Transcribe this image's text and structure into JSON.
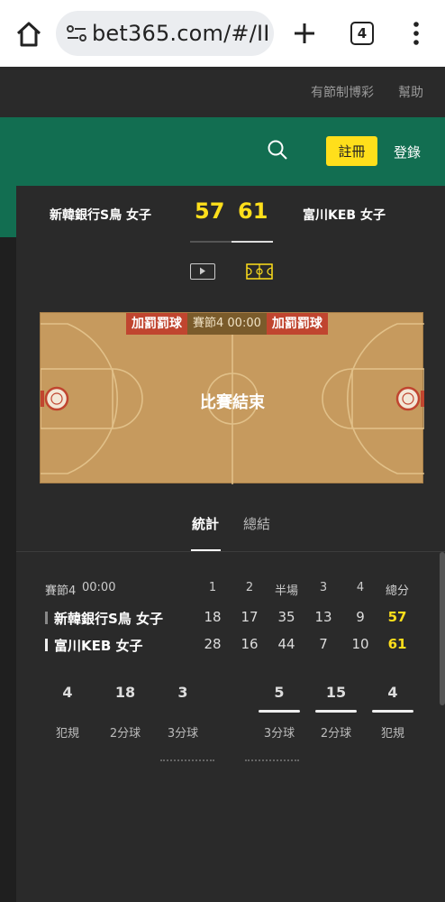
{
  "browser": {
    "url": "bet365.com/#/II",
    "tab_count": "4"
  },
  "top_links": {
    "responsible_gambling": "有節制博彩",
    "help": "幫助"
  },
  "header": {
    "register_label": "註冊",
    "login_label": "登錄"
  },
  "match": {
    "home_team": "新韓銀行S鳥 女子",
    "away_team": "富川KEB 女子",
    "home_score": "57",
    "away_score": "61",
    "court": {
      "left_banner": "加罰罰球",
      "period_time": "賽節4  00:00",
      "right_banner": "加罰罰球",
      "status": "比賽結束"
    }
  },
  "stat_tabs": {
    "stats": "統計",
    "summary": "總結"
  },
  "score_table": {
    "period_label": "賽節4",
    "clock": "00:00",
    "headers": [
      "1",
      "2",
      "半場",
      "3",
      "4",
      "總分"
    ],
    "rows": [
      {
        "team": "新韓銀行S鳥 女子",
        "values": [
          "18",
          "17",
          "35",
          "13",
          "9",
          "57"
        ]
      },
      {
        "team": "富川KEB 女子",
        "values": [
          "28",
          "16",
          "44",
          "7",
          "10",
          "61"
        ]
      }
    ]
  },
  "team_stats": {
    "home": [
      {
        "value": "4",
        "label": "犯規"
      },
      {
        "value": "18",
        "label": "2分球"
      },
      {
        "value": "3",
        "label": "3分球"
      }
    ],
    "away": [
      {
        "value": "5",
        "label": "3分球"
      },
      {
        "value": "15",
        "label": "2分球"
      },
      {
        "value": "4",
        "label": "犯規"
      }
    ]
  },
  "colors": {
    "accent_yellow": "#ffdf1b",
    "brand_green": "#126e51",
    "court": "#c69a5e",
    "banner_red": "#c0452f"
  }
}
